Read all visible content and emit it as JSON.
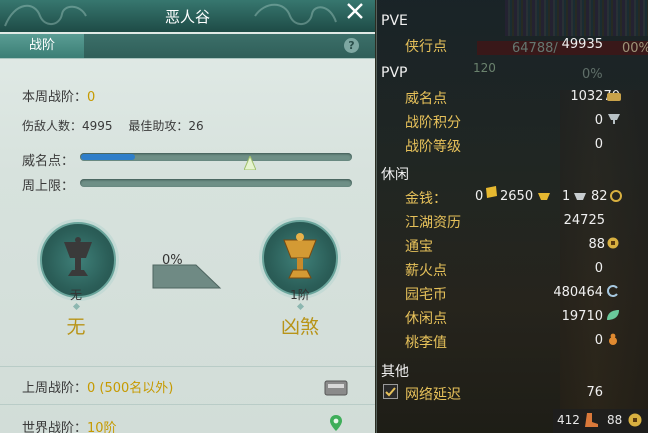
{
  "left_panel": {
    "title": "恶人谷",
    "tab": "战阶",
    "help": "?",
    "weekly_rank_label": "本周战阶：",
    "weekly_rank_value": "0",
    "kills_label": "伤敌人数：",
    "kills_value": "4995",
    "best_assist_label": "最佳助攻：",
    "best_assist_value": "26",
    "prestige_label": "威名点：",
    "prestige_progress": 0.2,
    "weekly_cap_label": "周上限：",
    "current_tier_label": "无",
    "current_tier_name": "无",
    "progress_text": "0%",
    "next_tier_label": "1阶",
    "next_tier_name": "凶煞",
    "last_week_label": "上周战阶：",
    "last_week_value": "0 (500名以外)",
    "world_rank_label": "世界战阶：",
    "world_rank_value": "10阶"
  },
  "right_panel": {
    "pve_header": "PVE",
    "pvp_header": "PVP",
    "leisure_header": "休闲",
    "other_header": "其他",
    "items": [
      {
        "label": "侠行点",
        "value": "49935",
        "icon": "sword-icon"
      },
      {
        "label": "威名点",
        "value": "103270",
        "icon": "prestige-icon"
      },
      {
        "label": "战阶积分",
        "value": "0",
        "icon": "rank-score-icon"
      },
      {
        "label": "战阶等级",
        "value": "0",
        "icon": ""
      },
      {
        "label": "江湖资历",
        "value": "24725",
        "icon": ""
      },
      {
        "label": "通宝",
        "value": "88",
        "icon": "coin-icon"
      },
      {
        "label": "薪火点",
        "value": "0",
        "icon": ""
      },
      {
        "label": "园宅币",
        "value": "480464",
        "icon": "home-coin-icon"
      },
      {
        "label": "休闲点",
        "value": "19710",
        "icon": "leaf-icon"
      },
      {
        "label": "桃李值",
        "value": "0",
        "icon": "gourd-icon"
      },
      {
        "label": "网络延迟",
        "value": "76",
        "icon": ""
      }
    ],
    "money_label": "金钱：",
    "money": {
      "brick": "0",
      "gold": "2650",
      "silver": "1",
      "copper": "82"
    },
    "bottom_left": "412",
    "bottom_right": "88"
  },
  "backdrop": {
    "bar_text": "64788/",
    "bar_pct": "00%",
    "level": "120",
    "pct2": "0%"
  }
}
